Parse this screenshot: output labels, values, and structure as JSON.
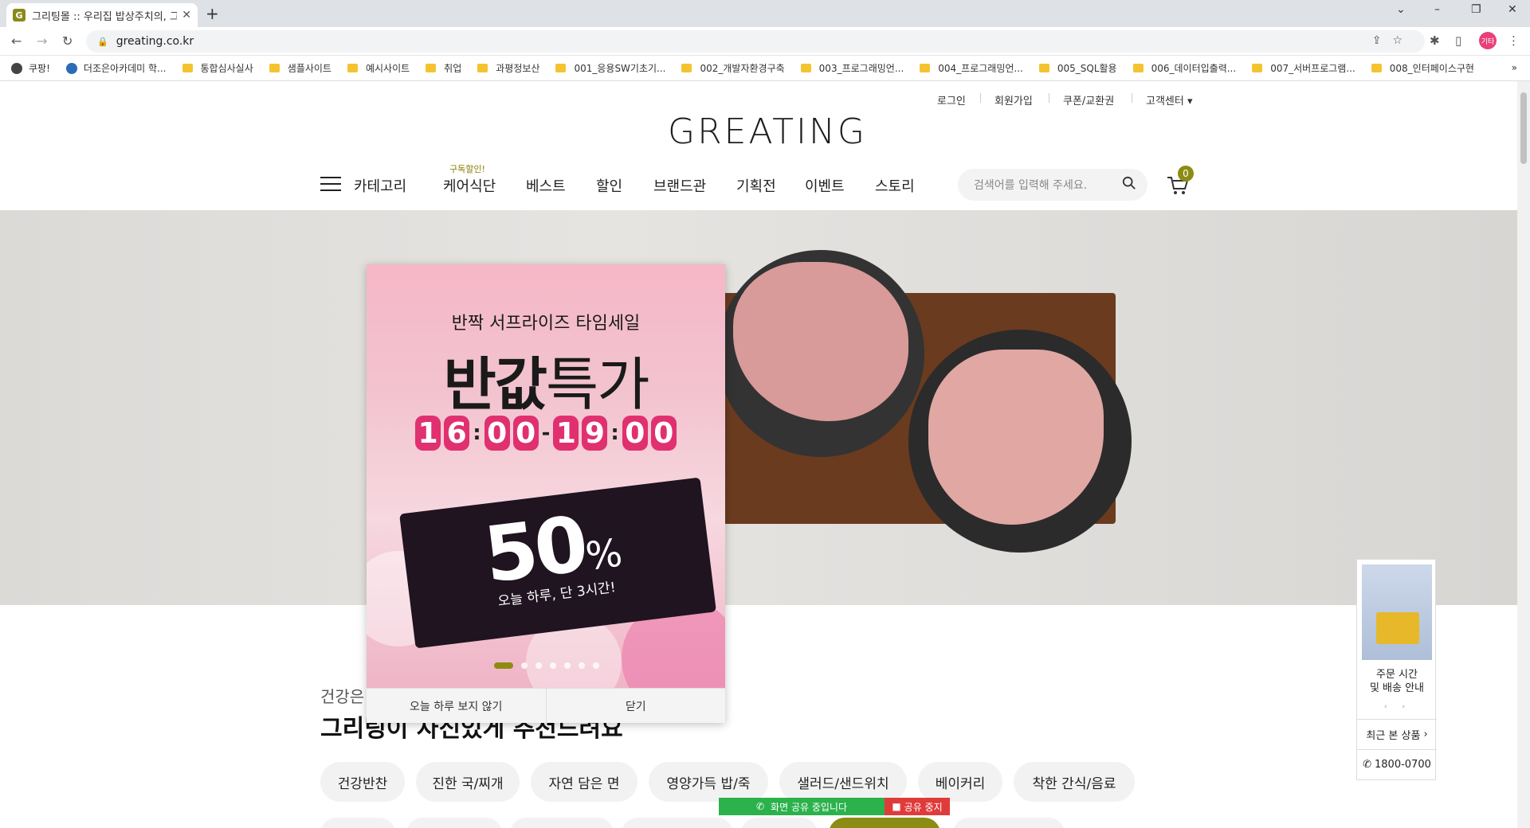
{
  "browser": {
    "tab_title": "그리팅몰 :: 우리집 밥상주치의, 그",
    "url": "greating.co.kr",
    "profile_label": "기타",
    "bookmarks": [
      "쿠팡!",
      "더조은아카데미 학...",
      "통합심사실사",
      "샘플사이트",
      "예시사이트",
      "취업",
      "과평정보산",
      "001_응용SW기초기...",
      "002_개발자환경구축",
      "003_프로그래밍언...",
      "004_프로그래밍언...",
      "005_SQL활용",
      "006_데이터입출력...",
      "007_서버프로그램...",
      "008_인터페이스구현"
    ],
    "bookmarks_more": "»"
  },
  "site": {
    "util_links": [
      "로그인",
      "회원가입",
      "쿠폰/교환권",
      "고객센터 ▾"
    ],
    "logo": "GREATING",
    "category_label": "카테고리",
    "nav_badge": "구독할인!",
    "nav": [
      "케어식단",
      "베스트",
      "할인",
      "브랜드관",
      "기획전",
      "이벤트",
      "스토리"
    ],
    "search_placeholder": "검색어를 입력해 주세요.",
    "cart_count": "0"
  },
  "popup": {
    "line1": "반짝 서프라이즈 타임세일",
    "title_bold": "반값",
    "title_rest": "특가",
    "time": [
      "1",
      "6",
      ":",
      "0",
      "0",
      "-",
      "1",
      "9",
      ":",
      "0",
      "0"
    ],
    "pct": "50",
    "pct_sign": "%",
    "sub": "오늘 하루, 단 3시간!",
    "slide_count": 7,
    "active_slide": 0,
    "dont_show_today": "오늘 하루 보지 않기",
    "close": "닫기"
  },
  "section": {
    "subtitle": "건강은",
    "title": "그리팅이 자신있게 추천드려요",
    "chips": [
      "건강반찬",
      "진한 국/찌개",
      "자연 담은 면",
      "영양가득 밥/죽",
      "샐러드/샌드위치",
      "베이커리",
      "착한 간식/음료"
    ]
  },
  "side_widget": {
    "label_line1": "주문 시간",
    "label_line2": "및 배송 안내",
    "arrows": "‹ ›",
    "recent": "최근 본 상품",
    "phone": "1800-0700"
  },
  "share_bar": {
    "message": "화면 공유 중입니다",
    "stop": "공유 중지"
  },
  "colors": {
    "brand": "#8c8b13",
    "time_digit": "#e0306f",
    "share_green": "#2bb24c",
    "share_red": "#e03b3b"
  }
}
